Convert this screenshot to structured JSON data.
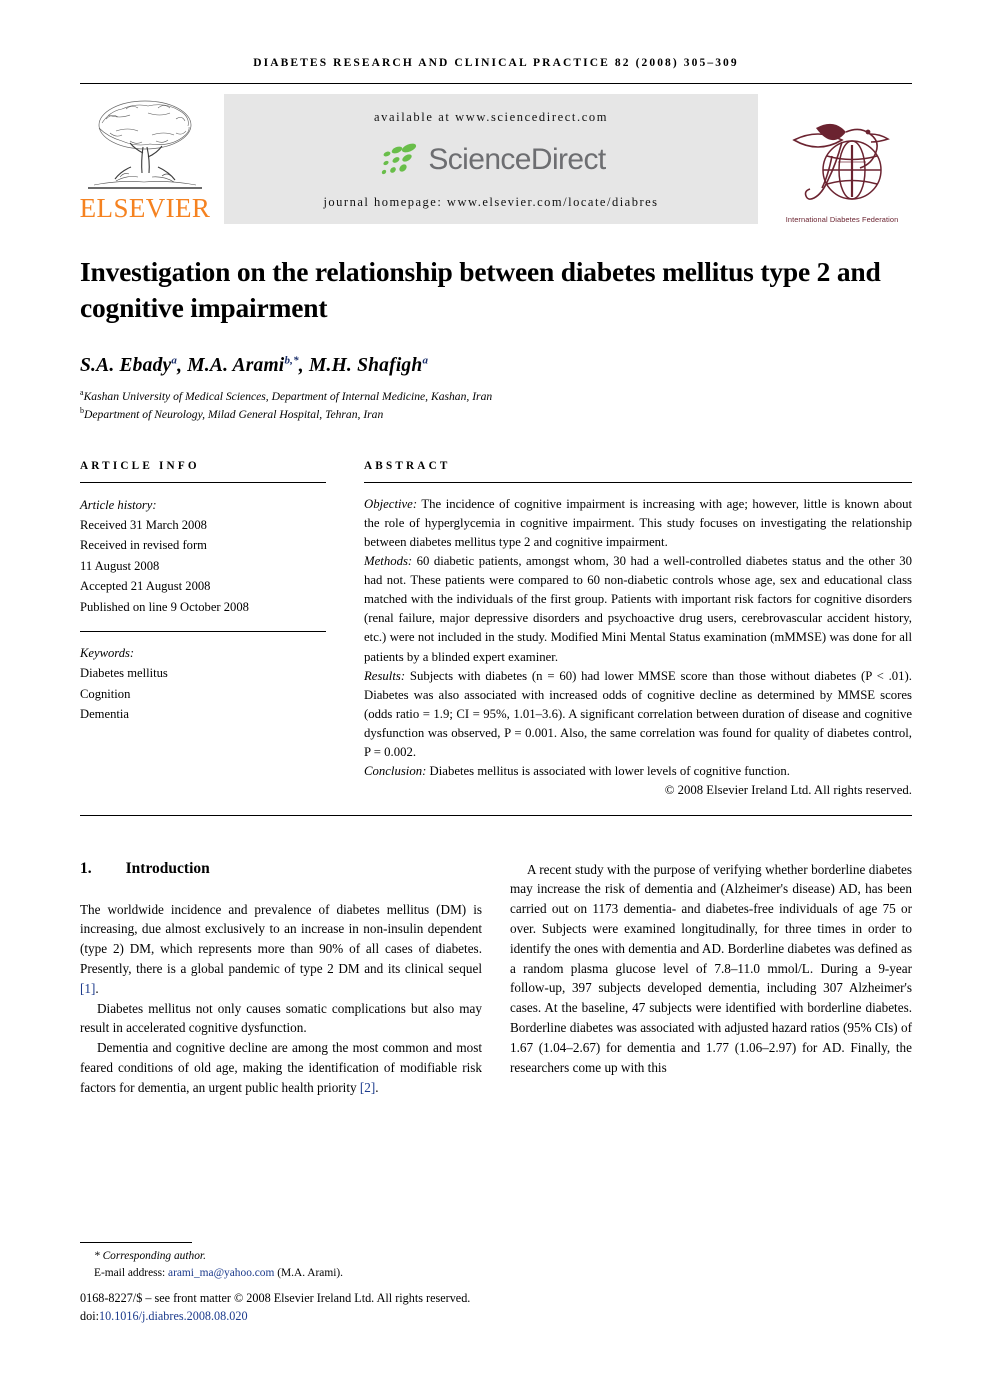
{
  "running_head": "DIABETES RESEARCH AND CLINICAL PRACTICE 82 (2008) 305–309",
  "masthead": {
    "publisher_wordmark": "ELSEVIER",
    "available_at": "available at www.sciencedirect.com",
    "sciencedirect_wordmark": "ScienceDirect",
    "journal_homepage": "journal homepage: www.elsevier.com/locate/diabres",
    "society_caption": "International Diabetes Federation",
    "colors": {
      "elsevier_orange": "#F58220",
      "sciencedirect_green": "#69BE4A",
      "sciencedirect_gray": "#6d6e71",
      "idf_maroon": "#6b2330",
      "banner_bg": "#e6e6e6"
    }
  },
  "article": {
    "title": "Investigation on the relationship between diabetes mellitus type 2 and cognitive impairment",
    "authors": [
      {
        "name": "S.A. Ebady",
        "marks": "a"
      },
      {
        "name": "M.A. Arami",
        "marks": "b,*"
      },
      {
        "name": "M.H. Shafigh",
        "marks": "a"
      }
    ],
    "affiliations": [
      {
        "mark": "a",
        "text": "Kashan University of Medical Sciences, Department of Internal Medicine, Kashan, Iran"
      },
      {
        "mark": "b",
        "text": "Department of Neurology, Milad General Hospital, Tehran, Iran"
      }
    ]
  },
  "article_info": {
    "heading": "ARTICLE INFO",
    "history_label": "Article history:",
    "history": [
      "Received 31 March 2008",
      "Received in revised form",
      "11 August 2008",
      "Accepted 21 August 2008",
      "Published on line 9 October 2008"
    ],
    "keywords_label": "Keywords:",
    "keywords": [
      "Diabetes mellitus",
      "Cognition",
      "Dementia"
    ]
  },
  "abstract": {
    "heading": "ABSTRACT",
    "objective_label": "Objective:",
    "objective_text": " The incidence of cognitive impairment is increasing with age; however, little is known about the role of hyperglycemia in cognitive impairment. This study focuses on investigating the relationship between diabetes mellitus type 2 and cognitive impairment.",
    "methods_label": "Methods:",
    "methods_text": " 60 diabetic patients, amongst whom, 30 had a well-controlled diabetes status and the other 30 had not. These patients were compared to 60 non-diabetic controls whose age, sex and educational class matched with the individuals of the first group. Patients with important risk factors for cognitive disorders (renal failure, major depressive disorders and psychoactive drug users, cerebrovascular accident history, etc.) were not included in the study. Modified Mini Mental Status examination (mMMSE) was done for all patients by a blinded expert examiner.",
    "results_label": "Results:",
    "results_text": " Subjects with diabetes (n = 60) had lower MMSE score than those without diabetes (P < .01). Diabetes was also associated with increased odds of cognitive decline as determined by MMSE scores (odds ratio = 1.9; CI = 95%, 1.01–3.6). A significant correlation between duration of disease and cognitive dysfunction was observed, P = 0.001. Also, the same correlation was found for quality of diabetes control, P = 0.002.",
    "conclusion_label": "Conclusion:",
    "conclusion_text": " Diabetes mellitus is associated with lower levels of cognitive function.",
    "copyright": "© 2008 Elsevier Ireland Ltd. All rights reserved."
  },
  "body": {
    "section_number": "1.",
    "section_title": "Introduction",
    "left_paragraphs": [
      "The worldwide incidence and prevalence of diabetes mellitus (DM) is increasing, due almost exclusively to an increase in non-insulin dependent (type 2) DM, which represents more than 90% of all cases of diabetes. Presently, there is a global pandemic of type 2 DM and its clinical sequel [1].",
      "Diabetes mellitus not only causes somatic complications but also may result in accelerated cognitive dysfunction.",
      "Dementia and cognitive decline are among the most common and most feared conditions of old age, making the identification of modifiable risk factors for dementia, an urgent public health priority [2]."
    ],
    "right_paragraphs": [
      "A recent study with the purpose of verifying whether borderline diabetes may increase the risk of dementia and (Alzheimer's disease) AD, has been carried out on 1173 dementia- and diabetes-free individuals of age 75 or over. Subjects were examined longitudinally, for three times in order to identify the ones with dementia and AD. Borderline diabetes was defined as a random plasma glucose level of 7.8–11.0 mmol/L. During a 9-year follow-up, 397 subjects developed dementia, including 307 Alzheimer's cases. At the baseline, 47 subjects were identified with borderline diabetes. Borderline diabetes was associated with adjusted hazard ratios (95% CIs) of 1.67 (1.04–2.67) for dementia and 1.77 (1.06–2.97) for AD. Finally, the researchers come up with this"
    ]
  },
  "footnote": {
    "corresponding_marker": "*",
    "corresponding_label": "Corresponding author.",
    "email_label": "E-mail address:",
    "email": "arami_ma@yahoo.com",
    "email_owner": "(M.A. Arami).",
    "front_matter": "0168-8227/$ – see front matter © 2008 Elsevier Ireland Ltd. All rights reserved.",
    "doi_label": "doi:",
    "doi": "10.1016/j.diabres.2008.08.020"
  }
}
